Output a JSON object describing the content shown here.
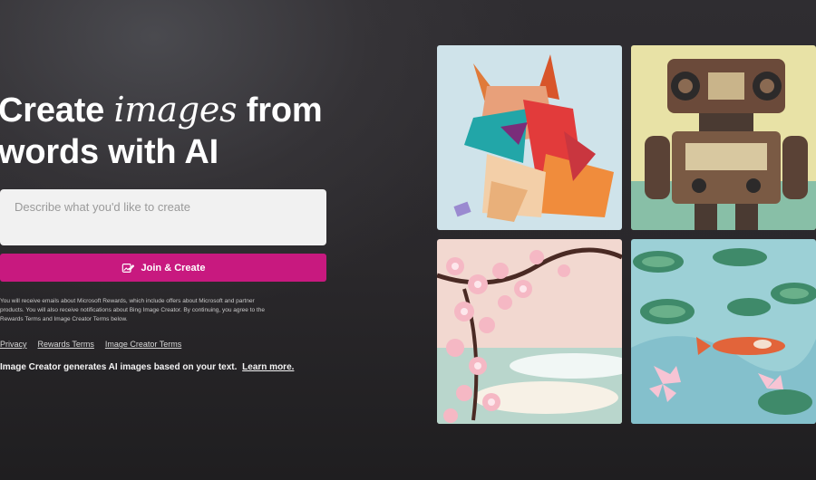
{
  "hero": {
    "title_line1_start": "Create ",
    "title_emphasis": "images",
    "title_line1_end": " from",
    "title_line2": "words with AI"
  },
  "prompt": {
    "placeholder": "Describe what you'd like to create",
    "value": ""
  },
  "cta": {
    "label": "Join & Create",
    "icon": "image-edit-icon",
    "color": "#c8197f"
  },
  "disclaimer": "You will receive emails about Microsoft Rewards, which include offers about Microsoft and partner products. You will also receive notifications about Bing Image Creator. By continuing, you agree to the Rewards Terms and Image Creator Terms below.",
  "footer_links": [
    "Privacy",
    "Rewards Terms",
    "Image Creator Terms"
  ],
  "info": {
    "text": "Image Creator generates AI images based on your text.",
    "learn_more": "Learn more."
  },
  "gallery": [
    {
      "subject": "origami-fox-image"
    },
    {
      "subject": "retro-robot-image"
    },
    {
      "subject": "cherry-blossom-image"
    },
    {
      "subject": "koi-pond-image"
    }
  ]
}
